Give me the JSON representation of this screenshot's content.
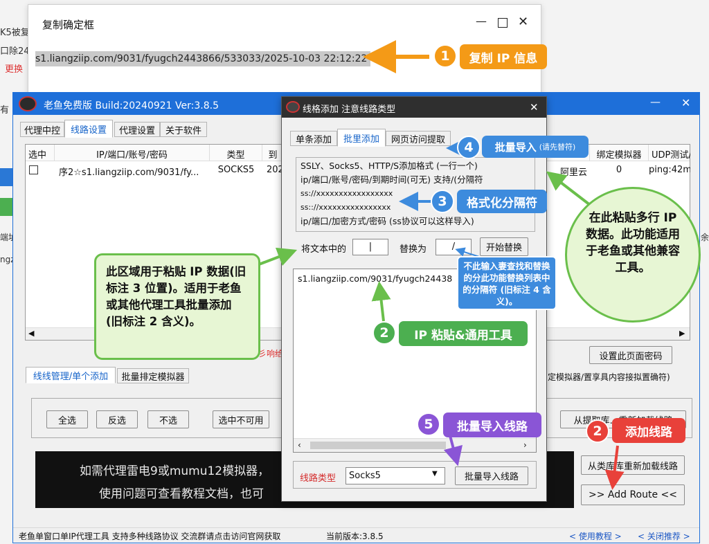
{
  "bg": {
    "left_fragments": [
      "K5被复",
      "口除24",
      "更换",
      "有",
      "区域",
      "端址",
      "ngz"
    ],
    "right_fragment": "余"
  },
  "confirm_dialog": {
    "title": "复制确定框",
    "text": "s1.liangziip.com/9031/fyugch2443866/533033/2025-10-03 22:12:22"
  },
  "main_window": {
    "title": "老鱼免费版 Build:20240921 Ver:3.8.5",
    "tabs": [
      "代理中控",
      "线路设置",
      "代理设置",
      "关于软件"
    ],
    "columns": [
      "选中",
      "IP/端口/账号/密码",
      "类型",
      "到",
      "绑定模拟器",
      "UDP测试/"
    ],
    "row": {
      "ip": "序2☆s1.liangziip.com/9031/fy...",
      "type": "SOCKS5",
      "date": "202",
      "provider": "阿里云",
      "emulator": "0",
      "udp": "ping:42m"
    },
    "set_password_button": "设置此页面密码",
    "bottom_tabs": [
      "线线管理/单个添加",
      "批量排定模拟器"
    ],
    "bottom_right_note": "定模拟器/置享具内容接拟置确符)",
    "red_fragment": "彡响给",
    "buttons": {
      "select_all": "全选",
      "invert": "反选",
      "deselect": "不选",
      "select_unavailable": "选中不可用",
      "load_from_extract": "从提取库…重新加载线路",
      "reload_from_library": "从类库库重新加载线路",
      "add_route": ">> Add Route <<"
    },
    "banner": {
      "line1": "如需代理雷电9或mumu12模拟器，",
      "line2": "使用问题可查看教程文档，也可"
    },
    "status": {
      "text": "老鱼单窗口单IP代理工具 支持多种线路协议 交流群请点击访问官网获取",
      "version": "当前版本:3.8.5",
      "tutorial": "< 使用教程 >",
      "close_recommend": "< 关闭推荐 >"
    }
  },
  "add_dialog": {
    "title": "线格添加 注意线路类型",
    "tabs": [
      "单条添加",
      "批里添加",
      "网页访问提取"
    ],
    "format_lines": [
      "SSLY、Socks5、HTTP/S添加格式 (一行一个)",
      "ip/端口/账号/密码/到期时间(可无) 支持/(分隔符",
      "ss://xxxxxxxxxxxxxxxxx",
      "ss:://xxxxxxxxxxxxxxxx",
      "ip/端口/加密方式/密码 (ss协议可以这样导入)"
    ],
    "replace_label": "将文本中的",
    "replace_from": "|",
    "replace_to_label": "替换为",
    "replace_to": "/",
    "replace_button": "开始替换",
    "textarea_text": "s1.liangziip.com/9031/fyugch24438",
    "line_type_label": "线路类型",
    "line_type_value": "Socks5",
    "import_button": "批量导入线路"
  },
  "annotations": {
    "a1": {
      "num": "1",
      "label": "复制 IP 信息"
    },
    "a2": {
      "num": "2",
      "label": "IP 粘贴&通用工具"
    },
    "a3": {
      "num": "3",
      "label": "格式化分隔符"
    },
    "a4": {
      "num": "4",
      "label": "批量导入",
      "sub": "(请先替符)"
    },
    "a5": {
      "num": "5",
      "label": "批量导入线路"
    },
    "a6": {
      "num": "2",
      "label": "添加线路"
    },
    "note_replace": "不此输入妻查找和替换的分此功能替换列表中的分隔符 (旧标注 4 含义)。",
    "left_callout": "此区域用于粘贴 IP 数据(旧标注 3 位置)。适用于老鱼或其他代理工具批量添加 (旧标注 2 含义)。",
    "right_callout": "在此粘贴多行 IP 数据。此功能适用于老鱼或其他兼容工具。"
  },
  "colors": {
    "orange": "#f49a17",
    "green": "#4caf50",
    "blue": "#3d8bdd",
    "purple": "#8a55d6",
    "red": "#e8413a",
    "titlebar": "#1e6fd9"
  }
}
